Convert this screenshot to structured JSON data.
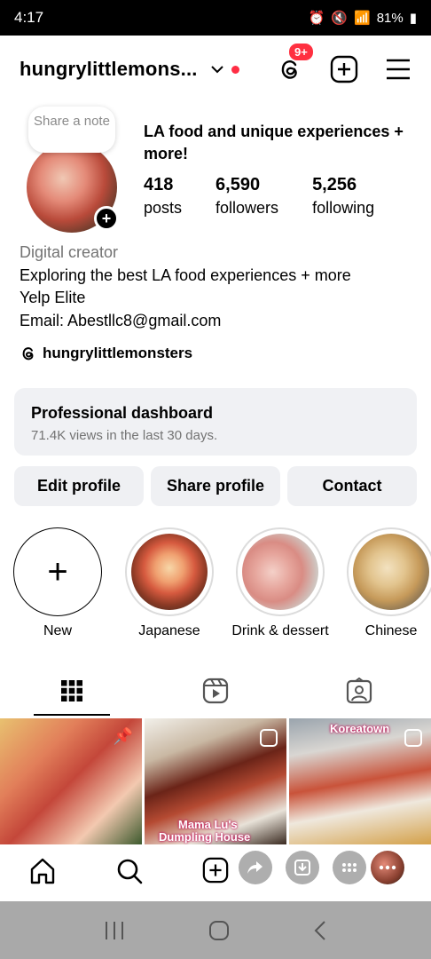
{
  "status_bar": {
    "time": "4:17",
    "battery": "81%"
  },
  "header": {
    "username": "hungrylittlemons...",
    "notification_badge": "9+"
  },
  "profile": {
    "note_placeholder": "Share a note",
    "headline": "LA food and unique experiences + more!",
    "stats": [
      {
        "value": "418",
        "label": "posts"
      },
      {
        "value": "6,590",
        "label": "followers"
      },
      {
        "value": "5,256",
        "label": "following"
      }
    ],
    "category": "Digital creator",
    "bio_lines": [
      "Exploring the best LA food experiences + more",
      "Yelp Elite",
      "Email: Abestllc8@gmail.com"
    ],
    "threads_handle": "hungrylittlemonsters"
  },
  "dashboard": {
    "title": "Professional dashboard",
    "subtitle": "71.4K views in the last 30 days."
  },
  "buttons": {
    "edit": "Edit profile",
    "share": "Share profile",
    "contact": "Contact"
  },
  "highlights": [
    {
      "label": "New"
    },
    {
      "label": "Japanese"
    },
    {
      "label": "Drink & dessert"
    },
    {
      "label": "Chinese"
    }
  ],
  "grid": {
    "post2_caption_1": "Mama Lu's",
    "post2_caption_2": "Dumpling House",
    "post3_caption": "Koreatown"
  },
  "colors": {
    "accent_red": "#ff3040",
    "surface": "#eff0f3"
  }
}
